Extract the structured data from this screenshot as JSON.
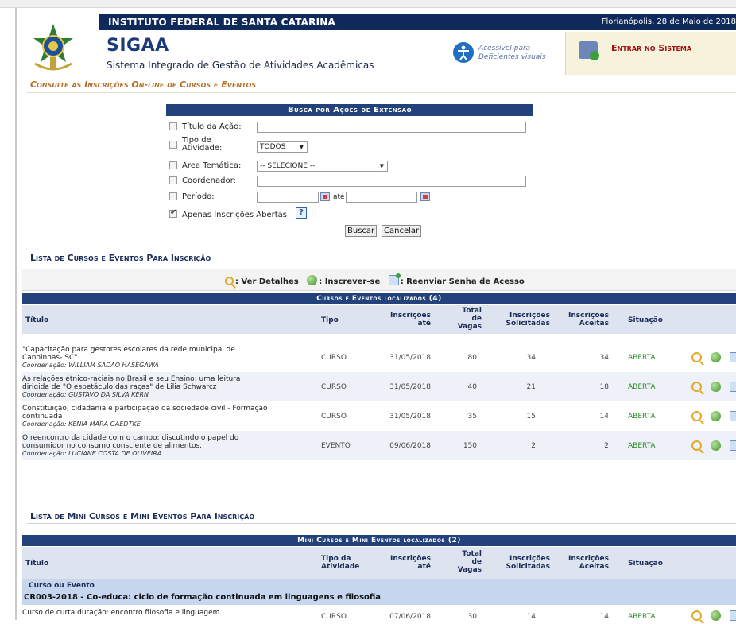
{
  "header": {
    "institution": "INSTITUTO FEDERAL DE SANTA CATARINA",
    "date": "Florianópolis, 28 de Maio de 2018",
    "app_name": "SIGAA",
    "app_subtitle": "Sistema Integrado de Gestão de Atividades Acadêmicas",
    "accessibility_line1": "Acessível para",
    "accessibility_line2": "Deficientes visuais",
    "login_label": "Entrar no Sistema"
  },
  "page_title": "Consulte as Inscrições On-line de Cursos e Eventos",
  "search": {
    "title": "Busca por Ações de Extensão",
    "titulo_label": "Título da Ação:",
    "tipo_label_1": "Tipo de",
    "tipo_label_2": "Atividade:",
    "tipo_value": "TODOS",
    "area_label": "Área Temática:",
    "area_value": "-- SELECIONE --",
    "coord_label": "Coordenador:",
    "periodo_label": "Período:",
    "ate": "até",
    "abertas_label": "Apenas Inscrições Abertas",
    "help": "?",
    "buscar": "Buscar",
    "cancelar": "Cancelar"
  },
  "legend": {
    "detalhes": ": Ver Detalhes",
    "inscrever": ": Inscrever-se",
    "reenviar": ": Reenviar Senha de Acesso"
  },
  "cursos": {
    "section_title": "Lista de Cursos e Eventos Para Inscrição",
    "table_title": "Cursos e Eventos localizados (4)",
    "headers": {
      "titulo": "Título",
      "tipo": "Tipo",
      "insc_ate_1": "Inscrições",
      "insc_ate_2": "até",
      "vagas_1": "Total",
      "vagas_2": "de",
      "vagas_3": "Vagas",
      "solic_1": "Inscrições",
      "solic_2": "Solicitadas",
      "aceitas_1": "Inscrições",
      "aceitas_2": "Aceitas",
      "situacao": "Situação"
    },
    "rows": [
      {
        "line1": "\"Capacitação para gestores escolares da rede municipal de",
        "line2": "Canoinhas- SC\"",
        "coord": "Coordenação: WILLIAM SADAO HASEGAWA",
        "tipo": "CURSO",
        "ate": "31/05/2018",
        "vagas": "80",
        "solic": "34",
        "aceitas": "34",
        "situacao": "ABERTA"
      },
      {
        "line1": "As relações étnico-raciais no Brasil e seu Ensino: uma leitura",
        "line2": "dirigida de \"O espetáculo das raças\" de Lilia Schwarcz",
        "coord": "Coordenação: GUSTAVO DA SILVA KERN",
        "tipo": "CURSO",
        "ate": "31/05/2018",
        "vagas": "40",
        "solic": "21",
        "aceitas": "18",
        "situacao": "ABERTA"
      },
      {
        "line1": "Constituição, cidadania e participação da sociedade civil - Formação",
        "line2": "continuada",
        "coord": "Coordenação: KENIA MARA GAEDTKE",
        "tipo": "CURSO",
        "ate": "31/05/2018",
        "vagas": "35",
        "solic": "15",
        "aceitas": "14",
        "situacao": "ABERTA"
      },
      {
        "line1": "O reencontro da cidade com o campo: discutindo o papel do",
        "line2": "consumidor no consumo consciente de alimentos.",
        "coord": "Coordenação: LUCIANE COSTA DE OLIVEIRA",
        "tipo": "EVENTO",
        "ate": "09/06/2018",
        "vagas": "150",
        "solic": "2",
        "aceitas": "2",
        "situacao": "ABERTA"
      }
    ]
  },
  "mini": {
    "section_title": "Lista de Mini Cursos e Mini Eventos Para Inscrição",
    "table_title": "Mini Cursos e Mini Eventos localizados (2)",
    "headers": {
      "titulo": "Título",
      "tipo_1": "Tipo da",
      "tipo_2": "Atividade",
      "insc_ate_1": "Inscrições",
      "insc_ate_2": "até",
      "vagas_1": "Total",
      "vagas_2": "de",
      "vagas_3": "Vagas",
      "solic_1": "Inscrições",
      "solic_2": "Solicitadas",
      "aceitas_1": "Inscrições",
      "aceitas_2": "Aceitas",
      "situacao": "Situação"
    },
    "group_label": "Curso ou Evento",
    "group_name": "CR003-2018 - Co-educa: ciclo de formação continuada em linguagens e filosofia",
    "rows": [
      {
        "line1": "Curso de curta duração: encontro filosofia e linguagem",
        "tipo": "CURSO",
        "ate": "07/06/2018",
        "vagas": "30",
        "solic": "14",
        "aceitas": "14",
        "situacao": "ABERTA"
      }
    ]
  },
  "colors": {
    "navy": "#23417a",
    "header_navy": "#0f2a5a",
    "login_red": "#a21212",
    "title_orange": "#b3722a",
    "open_green": "#2d8a2d"
  }
}
